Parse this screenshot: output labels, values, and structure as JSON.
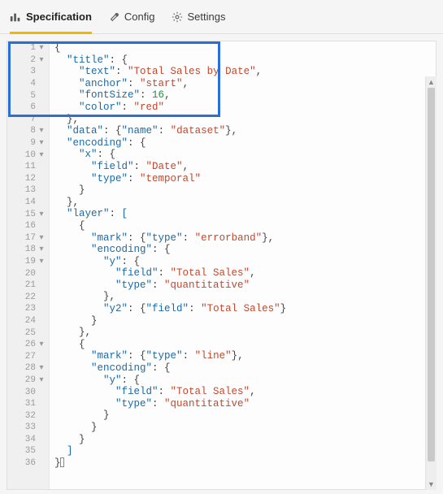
{
  "tabs": {
    "specification": "Specification",
    "config": "Config",
    "settings": "Settings"
  },
  "colors": {
    "tab_underline": "#f2b800",
    "highlight_border": "#2a6fd6",
    "json_key": "#1a6aa8",
    "json_string": "#c4472c",
    "json_number": "#2a8c4a"
  },
  "editor": {
    "fold_lines": [
      1,
      2,
      8,
      9,
      10,
      15,
      17,
      18,
      19,
      26,
      28,
      29
    ],
    "lines": [
      [
        [
          "punc",
          "{"
        ]
      ],
      [
        [
          "ind",
          1
        ],
        [
          "key",
          "\"title\""
        ],
        [
          "punc",
          ": {"
        ]
      ],
      [
        [
          "ind",
          2
        ],
        [
          "key",
          "\"text\""
        ],
        [
          "punc",
          ": "
        ],
        [
          "str",
          "\"Total Sales by Date\""
        ],
        [
          "punc",
          ","
        ]
      ],
      [
        [
          "ind",
          2
        ],
        [
          "key",
          "\"anchor\""
        ],
        [
          "punc",
          ": "
        ],
        [
          "str",
          "\"start\""
        ],
        [
          "punc",
          ","
        ]
      ],
      [
        [
          "ind",
          2
        ],
        [
          "key",
          "\"fontSize\""
        ],
        [
          "punc",
          ": "
        ],
        [
          "num",
          16
        ],
        [
          "punc",
          ","
        ]
      ],
      [
        [
          "ind",
          2
        ],
        [
          "key",
          "\"color\""
        ],
        [
          "punc",
          ": "
        ],
        [
          "str",
          "\"red\""
        ]
      ],
      [
        [
          "ind",
          1
        ],
        [
          "punc",
          "},"
        ]
      ],
      [
        [
          "ind",
          1
        ],
        [
          "key",
          "\"data\""
        ],
        [
          "punc",
          ": {"
        ],
        [
          "key",
          "\"name\""
        ],
        [
          "punc",
          ": "
        ],
        [
          "str",
          "\"dataset\""
        ],
        [
          "punc",
          "},"
        ]
      ],
      [
        [
          "ind",
          1
        ],
        [
          "key",
          "\"encoding\""
        ],
        [
          "punc",
          ": {"
        ]
      ],
      [
        [
          "ind",
          2
        ],
        [
          "key",
          "\"x\""
        ],
        [
          "punc",
          ": {"
        ]
      ],
      [
        [
          "ind",
          3
        ],
        [
          "key",
          "\"field\""
        ],
        [
          "punc",
          ": "
        ],
        [
          "str",
          "\"Date\""
        ],
        [
          "punc",
          ","
        ]
      ],
      [
        [
          "ind",
          3
        ],
        [
          "key",
          "\"type\""
        ],
        [
          "punc",
          ": "
        ],
        [
          "str",
          "\"temporal\""
        ]
      ],
      [
        [
          "ind",
          2
        ],
        [
          "punc",
          "}"
        ]
      ],
      [
        [
          "ind",
          1
        ],
        [
          "punc",
          "},"
        ]
      ],
      [
        [
          "ind",
          1
        ],
        [
          "key",
          "\"layer\""
        ],
        [
          "punc",
          ": "
        ],
        [
          "sqb",
          "["
        ]
      ],
      [
        [
          "ind",
          2
        ],
        [
          "punc",
          "{"
        ]
      ],
      [
        [
          "ind",
          3
        ],
        [
          "key",
          "\"mark\""
        ],
        [
          "punc",
          ": {"
        ],
        [
          "key",
          "\"type\""
        ],
        [
          "punc",
          ": "
        ],
        [
          "str",
          "\"errorband\""
        ],
        [
          "punc",
          "},"
        ]
      ],
      [
        [
          "ind",
          3
        ],
        [
          "key",
          "\"encoding\""
        ],
        [
          "punc",
          ": {"
        ]
      ],
      [
        [
          "ind",
          4
        ],
        [
          "key",
          "\"y\""
        ],
        [
          "punc",
          ": {"
        ]
      ],
      [
        [
          "ind",
          5
        ],
        [
          "key",
          "\"field\""
        ],
        [
          "punc",
          ": "
        ],
        [
          "str",
          "\"Total Sales\""
        ],
        [
          "punc",
          ","
        ]
      ],
      [
        [
          "ind",
          5
        ],
        [
          "key",
          "\"type\""
        ],
        [
          "punc",
          ": "
        ],
        [
          "str",
          "\"quantitative\""
        ]
      ],
      [
        [
          "ind",
          4
        ],
        [
          "punc",
          "},"
        ]
      ],
      [
        [
          "ind",
          4
        ],
        [
          "key",
          "\"y2\""
        ],
        [
          "punc",
          ": {"
        ],
        [
          "key",
          "\"field\""
        ],
        [
          "punc",
          ": "
        ],
        [
          "str",
          "\"Total Sales\""
        ],
        [
          "punc",
          "}"
        ]
      ],
      [
        [
          "ind",
          3
        ],
        [
          "punc",
          "}"
        ]
      ],
      [
        [
          "ind",
          2
        ],
        [
          "punc",
          "},"
        ]
      ],
      [
        [
          "ind",
          2
        ],
        [
          "punc",
          "{"
        ]
      ],
      [
        [
          "ind",
          3
        ],
        [
          "key",
          "\"mark\""
        ],
        [
          "punc",
          ": {"
        ],
        [
          "key",
          "\"type\""
        ],
        [
          "punc",
          ": "
        ],
        [
          "str",
          "\"line\""
        ],
        [
          "punc",
          "},"
        ]
      ],
      [
        [
          "ind",
          3
        ],
        [
          "key",
          "\"encoding\""
        ],
        [
          "punc",
          ": {"
        ]
      ],
      [
        [
          "ind",
          4
        ],
        [
          "key",
          "\"y\""
        ],
        [
          "punc",
          ": {"
        ]
      ],
      [
        [
          "ind",
          5
        ],
        [
          "key",
          "\"field\""
        ],
        [
          "punc",
          ": "
        ],
        [
          "str",
          "\"Total Sales\""
        ],
        [
          "punc",
          ","
        ]
      ],
      [
        [
          "ind",
          5
        ],
        [
          "key",
          "\"type\""
        ],
        [
          "punc",
          ": "
        ],
        [
          "str",
          "\"quantitative\""
        ]
      ],
      [
        [
          "ind",
          4
        ],
        [
          "punc",
          "}"
        ]
      ],
      [
        [
          "ind",
          3
        ],
        [
          "punc",
          "}"
        ]
      ],
      [
        [
          "ind",
          2
        ],
        [
          "punc",
          "}"
        ]
      ],
      [
        [
          "ind",
          1
        ],
        [
          "sqb",
          "]"
        ]
      ],
      [
        [
          "punc",
          "}"
        ],
        [
          "cursor",
          ""
        ]
      ]
    ]
  }
}
